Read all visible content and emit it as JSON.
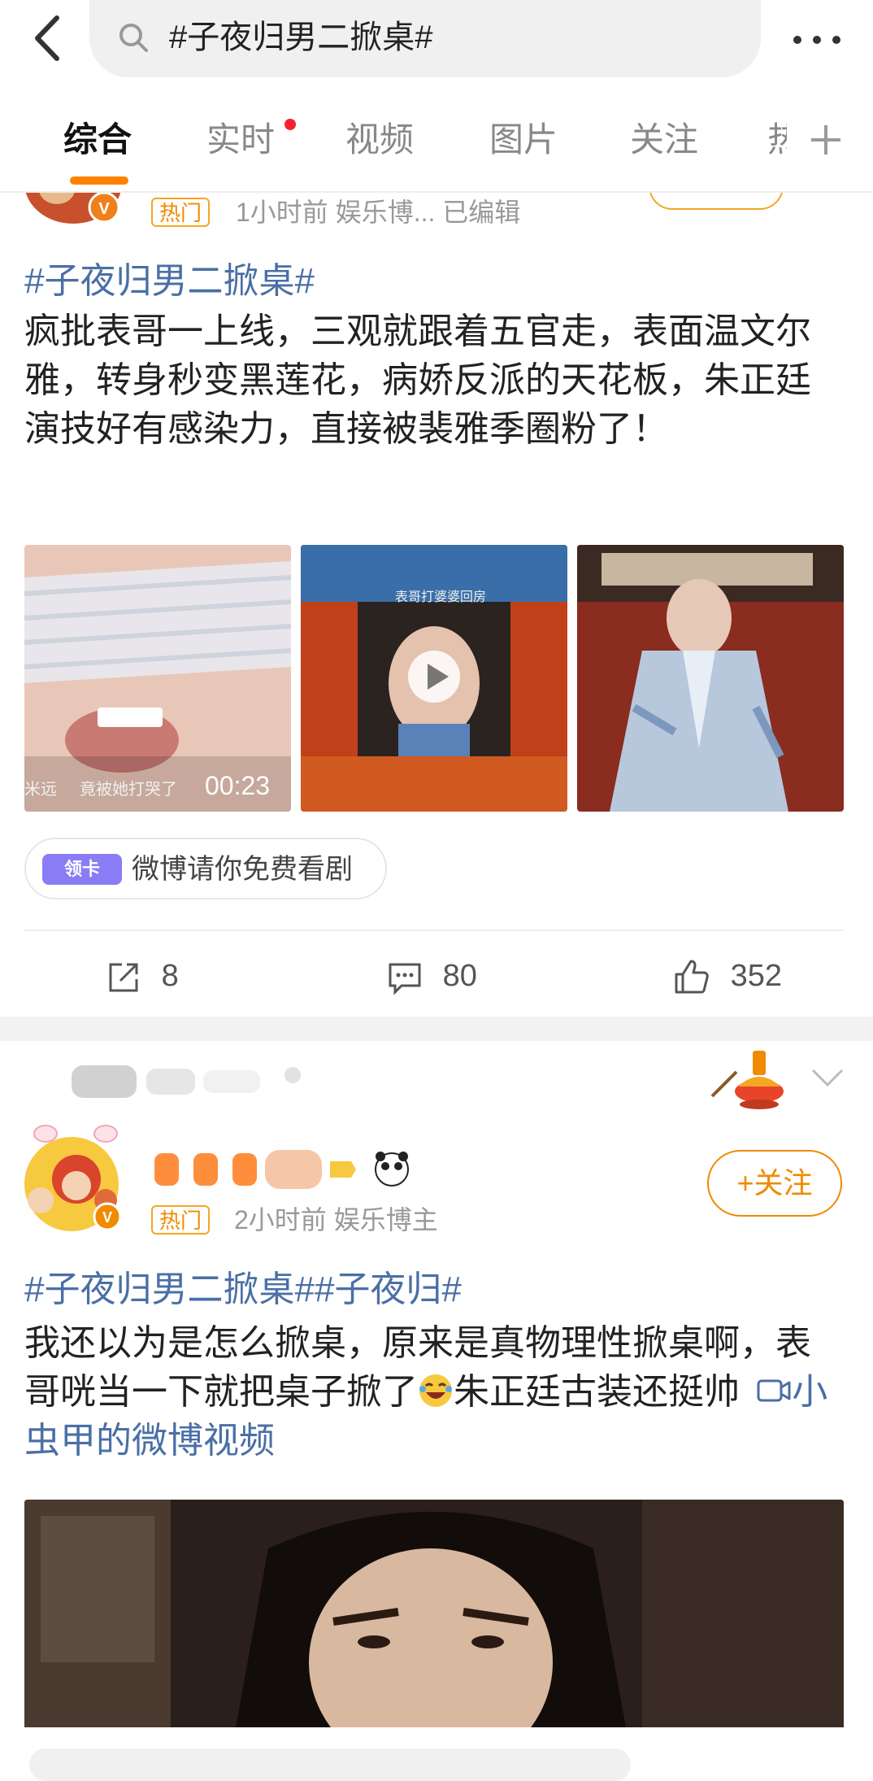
{
  "search": {
    "query": "#子夜归男二掀桌#"
  },
  "tabs": [
    {
      "label": "综合"
    },
    {
      "label": "实时"
    },
    {
      "label": "视频"
    },
    {
      "label": "图片"
    },
    {
      "label": "关注"
    },
    {
      "label": "热门"
    }
  ],
  "colors": {
    "accent": "#ff8200",
    "hashtag": "#4a6fa5",
    "hot": "#f08a00",
    "red_dot": "#f5222d"
  },
  "posts": [
    {
      "badge": "热门",
      "meta": "1小时前  娱乐博...  已编辑",
      "hashtag": "#子夜归男二掀桌#",
      "text": "疯批表哥一上线，三观就跟着五官走，表面温文尔雅，转身秒变黑莲花，病娇反派的天花板，朱正廷演技好有感染力，直接被裴雅季圈粉了！",
      "media": [
        {
          "icon": "video-thumbnail",
          "caption_left": "米远",
          "caption": "竟被她打哭了",
          "duration": "00:23"
        },
        {
          "icon": "video-thumbnail",
          "caption": "表哥打婆婆回房"
        },
        {
          "icon": "image-thumbnail"
        }
      ],
      "coupon": {
        "badge": "领卡",
        "text": "微博请你免费看剧"
      },
      "actions": {
        "reposts": "8",
        "comments": "80",
        "likes": "352"
      }
    },
    {
      "badge": "热门",
      "meta": "2小时前  娱乐博主",
      "follow_label": "+关注",
      "hashtags": "#子夜归男二掀桌##子夜归#",
      "text_part1": "我还以为是怎么掀桌，原来是真物理性掀桌啊，表哥咣当一下就把桌子掀了",
      "emoji": "laughing-emoji",
      "text_part2": "朱正廷古装还挺帅",
      "video_link": "小虫甲的微博视频"
    }
  ]
}
